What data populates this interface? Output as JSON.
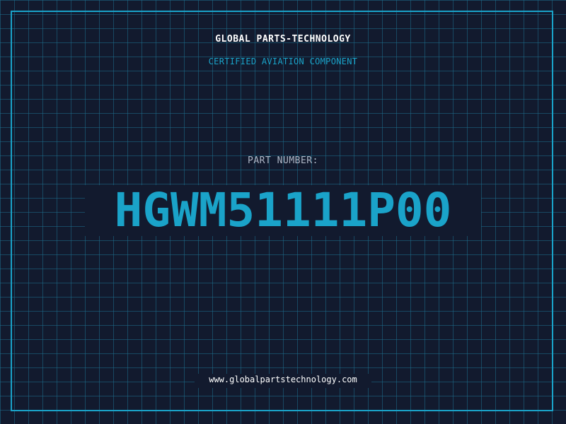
{
  "label": {
    "company": "GLOBAL PARTS-TECHNOLOGY",
    "subtitle": "CERTIFIED AVIATION COMPONENT",
    "part_number_label": "PART NUMBER:",
    "part_number": "HGWM51111P00",
    "website": "www.globalpartstechnology.com"
  },
  "colors": {
    "background": "#121a2e",
    "grid": "#1e6e8c",
    "accent": "#1aa3c9",
    "primary_text": "#ffffff",
    "muted_text": "#aeb7c6"
  }
}
